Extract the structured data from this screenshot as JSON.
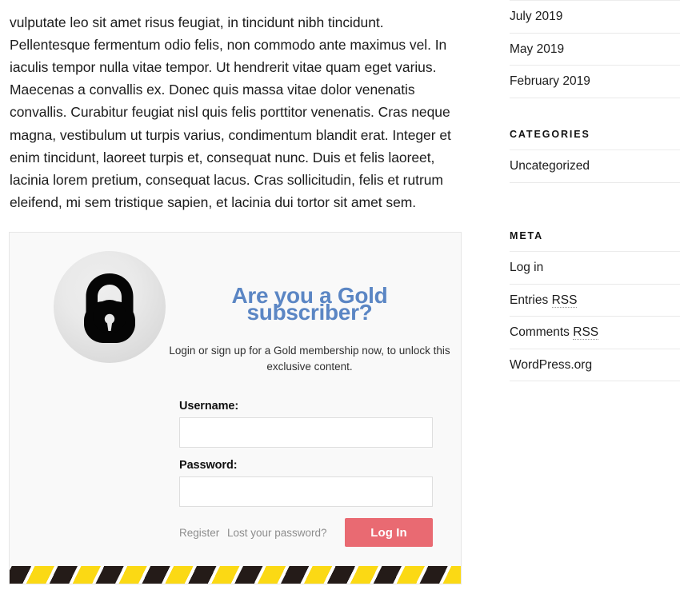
{
  "post": {
    "body_text": "vulputate leo sit amet risus feugiat, in tincidunt nibh tincidunt. Pellentesque fermentum odio felis, non commodo ante maximus vel. In iaculis tempor nulla vitae tempor. Ut hendrerit vitae quam eget varius. Maecenas a convallis ex. Donec quis massa vitae dolor venenatis convallis. Curabitur feugiat nisl quis felis porttitor venenatis. Cras neque magna, vestibulum ut turpis varius, condimentum blandit erat. Integer et enim tincidunt, laoreet turpis et, consequat nunc. Duis et felis laoreet, lacinia lorem pretium, consequat lacus. Cras sollicitudin, felis et rutrum eleifend, mi sem tristique sapien, et lacinia dui tortor sit amet sem."
  },
  "paywall": {
    "icon": "padlock-icon",
    "heading": "Are you a Gold subscriber?",
    "subtext": "Login or sign up for a Gold membership now, to unlock this exclusive content.",
    "username_label": "Username:",
    "username_value": "",
    "username_placeholder": "",
    "password_label": "Password:",
    "password_value": "",
    "password_placeholder": "",
    "register_link": "Register",
    "lost_password_link": "Lost your password?",
    "login_button": "Log In",
    "accent_color": "#5b86c4",
    "button_color": "#e96a72",
    "hazard_colors": [
      "#fbd914",
      "#241b18"
    ]
  },
  "sidebar": {
    "archives": {
      "items": [
        {
          "label": "July 2019"
        },
        {
          "label": "May 2019"
        },
        {
          "label": "February 2019"
        }
      ]
    },
    "categories": {
      "title": "Categories",
      "items": [
        {
          "label": "Uncategorized"
        }
      ]
    },
    "meta": {
      "title": "Meta",
      "items": [
        {
          "label": "Log in",
          "abbr": ""
        },
        {
          "label": "Entries ",
          "abbr": "RSS"
        },
        {
          "label": "Comments ",
          "abbr": "RSS"
        },
        {
          "label": "WordPress.org",
          "abbr": ""
        }
      ]
    }
  }
}
